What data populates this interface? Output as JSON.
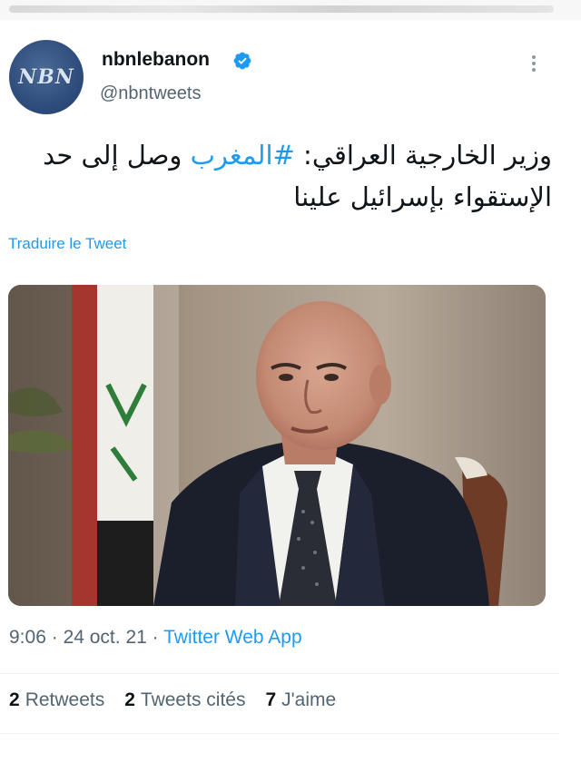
{
  "tweet": {
    "display_name": "nbnlebanon",
    "handle": "@nbntweets",
    "avatar_logo": "NBN",
    "text_parts": {
      "before": "وزير الخارجية العراقي: ",
      "hashtag": "#المغرب",
      "after": " وصل إلى حد الإستقواء بإسرائيل علينا"
    },
    "translate_label": "Traduire le Tweet",
    "time": "9:06",
    "date": "24 oct. 21",
    "source_app": "Twitter Web App",
    "separator": "·"
  },
  "stats": {
    "retweets_count": "2",
    "retweets_label": "Retweets",
    "quotes_count": "2",
    "quotes_label": "Tweets cités",
    "likes_count": "7",
    "likes_label": "J'aime"
  },
  "colors": {
    "link": "#1d9bf0",
    "secondary_text": "#536471",
    "verified": "#1d9bf0"
  },
  "icons": [
    "verified-badge-icon",
    "more-options-icon"
  ]
}
